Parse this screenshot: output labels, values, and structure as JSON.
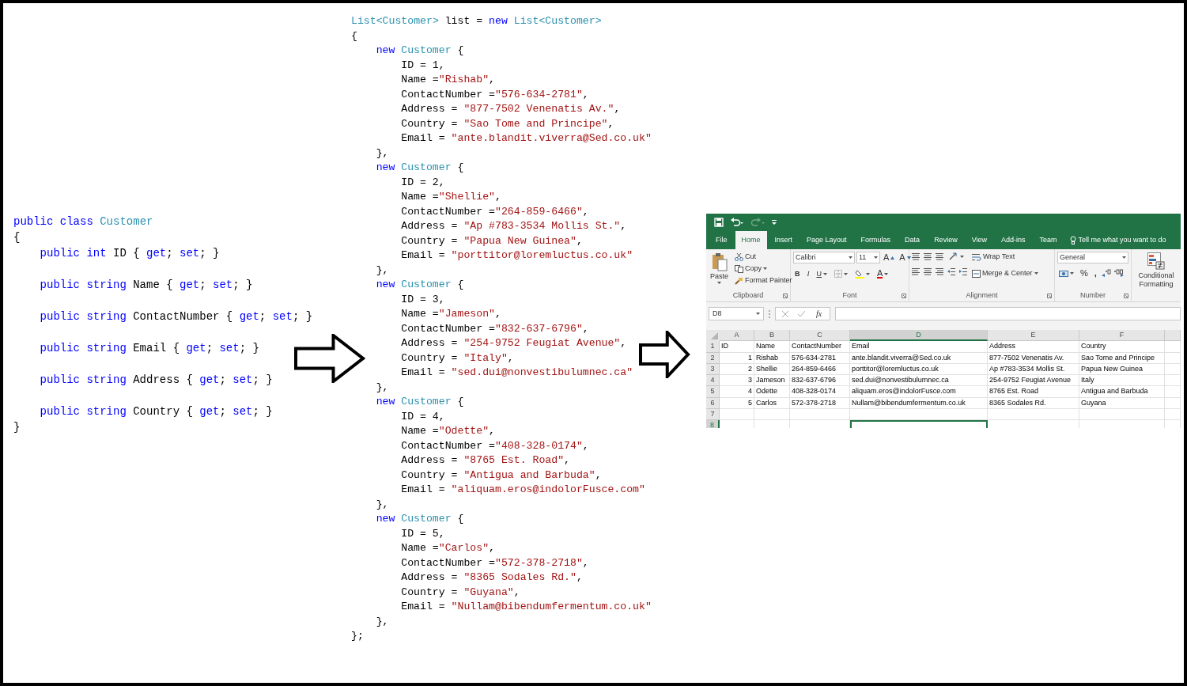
{
  "class_code": {
    "header": [
      {
        "kind": "keyword",
        "t": "public class "
      },
      {
        "kind": "type",
        "t": "Customer"
      }
    ],
    "open": "{",
    "members": [
      [
        {
          "kind": "keyword",
          "t": "public int "
        },
        {
          "kind": "plain",
          "t": "ID { "
        },
        {
          "kind": "keyword",
          "t": "get"
        },
        {
          "kind": "plain",
          "t": "; "
        },
        {
          "kind": "keyword",
          "t": "set"
        },
        {
          "kind": "plain",
          "t": "; }"
        }
      ],
      [
        {
          "kind": "keyword",
          "t": "public string "
        },
        {
          "kind": "plain",
          "t": "Name { "
        },
        {
          "kind": "keyword",
          "t": "get"
        },
        {
          "kind": "plain",
          "t": "; "
        },
        {
          "kind": "keyword",
          "t": "set"
        },
        {
          "kind": "plain",
          "t": "; }"
        }
      ],
      [
        {
          "kind": "keyword",
          "t": "public string "
        },
        {
          "kind": "plain",
          "t": "ContactNumber { "
        },
        {
          "kind": "keyword",
          "t": "get"
        },
        {
          "kind": "plain",
          "t": "; "
        },
        {
          "kind": "keyword",
          "t": "set"
        },
        {
          "kind": "plain",
          "t": "; }"
        }
      ],
      [
        {
          "kind": "keyword",
          "t": "public string "
        },
        {
          "kind": "plain",
          "t": "Email { "
        },
        {
          "kind": "keyword",
          "t": "get"
        },
        {
          "kind": "plain",
          "t": "; "
        },
        {
          "kind": "keyword",
          "t": "set"
        },
        {
          "kind": "plain",
          "t": "; }"
        }
      ],
      [
        {
          "kind": "keyword",
          "t": "public string "
        },
        {
          "kind": "plain",
          "t": "Address { "
        },
        {
          "kind": "keyword",
          "t": "get"
        },
        {
          "kind": "plain",
          "t": "; "
        },
        {
          "kind": "keyword",
          "t": "set"
        },
        {
          "kind": "plain",
          "t": "; }"
        }
      ],
      [
        {
          "kind": "keyword",
          "t": "public string "
        },
        {
          "kind": "plain",
          "t": "Country { "
        },
        {
          "kind": "keyword",
          "t": "get"
        },
        {
          "kind": "plain",
          "t": "; "
        },
        {
          "kind": "keyword",
          "t": "set"
        },
        {
          "kind": "plain",
          "t": "; }"
        }
      ]
    ],
    "close": "}"
  },
  "list_code": {
    "declaration": [
      {
        "kind": "type",
        "t": "List<Customer>"
      },
      {
        "kind": "plain",
        "t": " list = "
      },
      {
        "kind": "keyword",
        "t": "new "
      },
      {
        "kind": "type",
        "t": "List<Customer>"
      }
    ],
    "open": "{",
    "items": [
      {
        "header": [
          {
            "kind": "keyword",
            "t": "new "
          },
          {
            "kind": "type",
            "t": "Customer"
          },
          {
            "kind": "plain",
            "t": " {"
          }
        ],
        "fields": [
          [
            {
              "kind": "plain",
              "t": "ID = 1,"
            }
          ],
          [
            {
              "kind": "plain",
              "t": "Name ="
            },
            {
              "kind": "string",
              "t": "\"Rishab\""
            },
            {
              "kind": "plain",
              "t": ","
            }
          ],
          [
            {
              "kind": "plain",
              "t": "ContactNumber ="
            },
            {
              "kind": "string",
              "t": "\"576-634-2781\""
            },
            {
              "kind": "plain",
              "t": ","
            }
          ],
          [
            {
              "kind": "plain",
              "t": "Address = "
            },
            {
              "kind": "string",
              "t": "\"877-7502 Venenatis Av.\""
            },
            {
              "kind": "plain",
              "t": ","
            }
          ],
          [
            {
              "kind": "plain",
              "t": "Country = "
            },
            {
              "kind": "string",
              "t": "\"Sao Tome and Principe\""
            },
            {
              "kind": "plain",
              "t": ","
            }
          ],
          [
            {
              "kind": "plain",
              "t": "Email = "
            },
            {
              "kind": "string",
              "t": "\"ante.blandit.viverra@Sed.co.uk\""
            }
          ]
        ],
        "close": "},"
      },
      {
        "header": [
          {
            "kind": "keyword",
            "t": "new "
          },
          {
            "kind": "type",
            "t": "Customer"
          },
          {
            "kind": "plain",
            "t": " {"
          }
        ],
        "fields": [
          [
            {
              "kind": "plain",
              "t": "ID = 2,"
            }
          ],
          [
            {
              "kind": "plain",
              "t": "Name ="
            },
            {
              "kind": "string",
              "t": "\"Shellie\""
            },
            {
              "kind": "plain",
              "t": ","
            }
          ],
          [
            {
              "kind": "plain",
              "t": "ContactNumber ="
            },
            {
              "kind": "string",
              "t": "\"264-859-6466\""
            },
            {
              "kind": "plain",
              "t": ","
            }
          ],
          [
            {
              "kind": "plain",
              "t": "Address = "
            },
            {
              "kind": "string",
              "t": "\"Ap #783-3534 Mollis St.\""
            },
            {
              "kind": "plain",
              "t": ","
            }
          ],
          [
            {
              "kind": "plain",
              "t": "Country = "
            },
            {
              "kind": "string",
              "t": "\"Papua New Guinea\""
            },
            {
              "kind": "plain",
              "t": ","
            }
          ],
          [
            {
              "kind": "plain",
              "t": "Email = "
            },
            {
              "kind": "string",
              "t": "\"porttitor@loremluctus.co.uk\""
            }
          ]
        ],
        "close": "},"
      },
      {
        "header": [
          {
            "kind": "keyword",
            "t": "new "
          },
          {
            "kind": "type",
            "t": "Customer"
          },
          {
            "kind": "plain",
            "t": " {"
          }
        ],
        "fields": [
          [
            {
              "kind": "plain",
              "t": "ID = 3,"
            }
          ],
          [
            {
              "kind": "plain",
              "t": "Name ="
            },
            {
              "kind": "string",
              "t": "\"Jameson\""
            },
            {
              "kind": "plain",
              "t": ","
            }
          ],
          [
            {
              "kind": "plain",
              "t": "ContactNumber ="
            },
            {
              "kind": "string",
              "t": "\"832-637-6796\""
            },
            {
              "kind": "plain",
              "t": ","
            }
          ],
          [
            {
              "kind": "plain",
              "t": "Address = "
            },
            {
              "kind": "string",
              "t": "\"254-9752 Feugiat Avenue\""
            },
            {
              "kind": "plain",
              "t": ","
            }
          ],
          [
            {
              "kind": "plain",
              "t": "Country = "
            },
            {
              "kind": "string",
              "t": "\"Italy\""
            },
            {
              "kind": "plain",
              "t": ","
            }
          ],
          [
            {
              "kind": "plain",
              "t": "Email = "
            },
            {
              "kind": "string",
              "t": "\"sed.dui@nonvestibulumnec.ca\""
            }
          ]
        ],
        "close": "},"
      },
      {
        "header": [
          {
            "kind": "keyword",
            "t": "new "
          },
          {
            "kind": "type",
            "t": "Customer"
          },
          {
            "kind": "plain",
            "t": " {"
          }
        ],
        "fields": [
          [
            {
              "kind": "plain",
              "t": "ID = 4,"
            }
          ],
          [
            {
              "kind": "plain",
              "t": "Name ="
            },
            {
              "kind": "string",
              "t": "\"Odette\""
            },
            {
              "kind": "plain",
              "t": ","
            }
          ],
          [
            {
              "kind": "plain",
              "t": "ContactNumber ="
            },
            {
              "kind": "string",
              "t": "\"408-328-0174\""
            },
            {
              "kind": "plain",
              "t": ","
            }
          ],
          [
            {
              "kind": "plain",
              "t": "Address = "
            },
            {
              "kind": "string",
              "t": "\"8765 Est. Road\""
            },
            {
              "kind": "plain",
              "t": ","
            }
          ],
          [
            {
              "kind": "plain",
              "t": "Country = "
            },
            {
              "kind": "string",
              "t": "\"Antigua and Barbuda\""
            },
            {
              "kind": "plain",
              "t": ","
            }
          ],
          [
            {
              "kind": "plain",
              "t": "Email = "
            },
            {
              "kind": "string",
              "t": "\"aliquam.eros@indolorFusce.com\""
            }
          ]
        ],
        "close": "},"
      },
      {
        "header": [
          {
            "kind": "keyword",
            "t": "new "
          },
          {
            "kind": "type",
            "t": "Customer"
          },
          {
            "kind": "plain",
            "t": " {"
          }
        ],
        "fields": [
          [
            {
              "kind": "plain",
              "t": "ID = 5,"
            }
          ],
          [
            {
              "kind": "plain",
              "t": "Name ="
            },
            {
              "kind": "string",
              "t": "\"Carlos\""
            },
            {
              "kind": "plain",
              "t": ","
            }
          ],
          [
            {
              "kind": "plain",
              "t": "ContactNumber ="
            },
            {
              "kind": "string",
              "t": "\"572-378-2718\""
            },
            {
              "kind": "plain",
              "t": ","
            }
          ],
          [
            {
              "kind": "plain",
              "t": "Address = "
            },
            {
              "kind": "string",
              "t": "\"8365 Sodales Rd.\""
            },
            {
              "kind": "plain",
              "t": ","
            }
          ],
          [
            {
              "kind": "plain",
              "t": "Country = "
            },
            {
              "kind": "string",
              "t": "\"Guyana\""
            },
            {
              "kind": "plain",
              "t": ","
            }
          ],
          [
            {
              "kind": "plain",
              "t": "Email = "
            },
            {
              "kind": "string",
              "t": "\"Nullam@bibendumfermentum.co.uk\""
            }
          ]
        ],
        "close": "},"
      }
    ],
    "close": "};"
  },
  "excel": {
    "quick_access": [
      {
        "kind": "save",
        "disabled": false
      },
      {
        "kind": "undo",
        "disabled": false
      },
      {
        "kind": "redo",
        "disabled": true
      },
      {
        "kind": "customize",
        "disabled": false
      }
    ],
    "tabs": [
      {
        "label": "File",
        "selected": false
      },
      {
        "label": "Home",
        "selected": true
      },
      {
        "label": "Insert",
        "selected": false
      },
      {
        "label": "Page Layout",
        "selected": false
      },
      {
        "label": "Formulas",
        "selected": false
      },
      {
        "label": "Data",
        "selected": false
      },
      {
        "label": "Review",
        "selected": false
      },
      {
        "label": "View",
        "selected": false
      },
      {
        "label": "Add-ins",
        "selected": false
      },
      {
        "label": "Team",
        "selected": false
      }
    ],
    "tell_me": "Tell me what you want to do",
    "clipboard": {
      "paste": "Paste",
      "cut": "Cut",
      "copy": "Copy",
      "format_painter": "Format Painter",
      "label": "Clipboard"
    },
    "font": {
      "name": "Calibri",
      "size": "11",
      "grow": "A",
      "shrink": "A",
      "bold": "B",
      "italic": "I",
      "underline": "U",
      "font_color": "A",
      "label": "Font"
    },
    "alignment": {
      "wrap_text": "Wrap Text",
      "merge": "Merge & Center",
      "label": "Alignment"
    },
    "number": {
      "format": "General",
      "percent": "%",
      "comma": ",",
      "label": "Number"
    },
    "styles": {
      "conditional_formatting": "Conditional Formatting"
    },
    "name_box": "D8",
    "fx": "fx",
    "grid": {
      "columns": [
        {
          "label": "A",
          "selected": false
        },
        {
          "label": "B",
          "selected": false
        },
        {
          "label": "C",
          "selected": false
        },
        {
          "label": "D",
          "selected": true
        },
        {
          "label": "E",
          "selected": false
        },
        {
          "label": "F",
          "selected": false
        }
      ],
      "rows": [
        {
          "number": "1",
          "kind": "header",
          "selected": false,
          "cells": [
            "ID",
            "Name",
            "ContactNumber",
            "Email",
            "Address",
            "Country"
          ]
        },
        {
          "number": "2",
          "kind": "data",
          "selected": false,
          "cells": [
            "1",
            "Rishab",
            "576-634-2781",
            "ante.blandit.viverra@Sed.co.uk",
            "877-7502 Venenatis Av.",
            "Sao Tome and Principe"
          ]
        },
        {
          "number": "3",
          "kind": "data",
          "selected": false,
          "cells": [
            "2",
            "Shellie",
            "264-859-6466",
            "porttitor@loremluctus.co.uk",
            "Ap #783-3534 Mollis St.",
            "Papua New Guinea"
          ]
        },
        {
          "number": "4",
          "kind": "data",
          "selected": false,
          "cells": [
            "3",
            "Jameson",
            "832-637-6796",
            "sed.dui@nonvestibulumnec.ca",
            "254-9752 Feugiat Avenue",
            "Italy"
          ]
        },
        {
          "number": "5",
          "kind": "data",
          "selected": false,
          "cells": [
            "4",
            "Odette",
            "408-328-0174",
            "aliquam.eros@indolorFusce.com",
            "8765 Est. Road",
            "Antigua and Barbuda"
          ]
        },
        {
          "number": "6",
          "kind": "data",
          "selected": false,
          "cells": [
            "5",
            "Carlos",
            "572-378-2718",
            "Nullam@bibendumfermentum.co.uk",
            "8365 Sodales Rd.",
            "Guyana"
          ]
        },
        {
          "number": "7",
          "kind": "data",
          "selected": false
        },
        {
          "number": "8",
          "kind": "data",
          "selected": true
        }
      ]
    }
  }
}
